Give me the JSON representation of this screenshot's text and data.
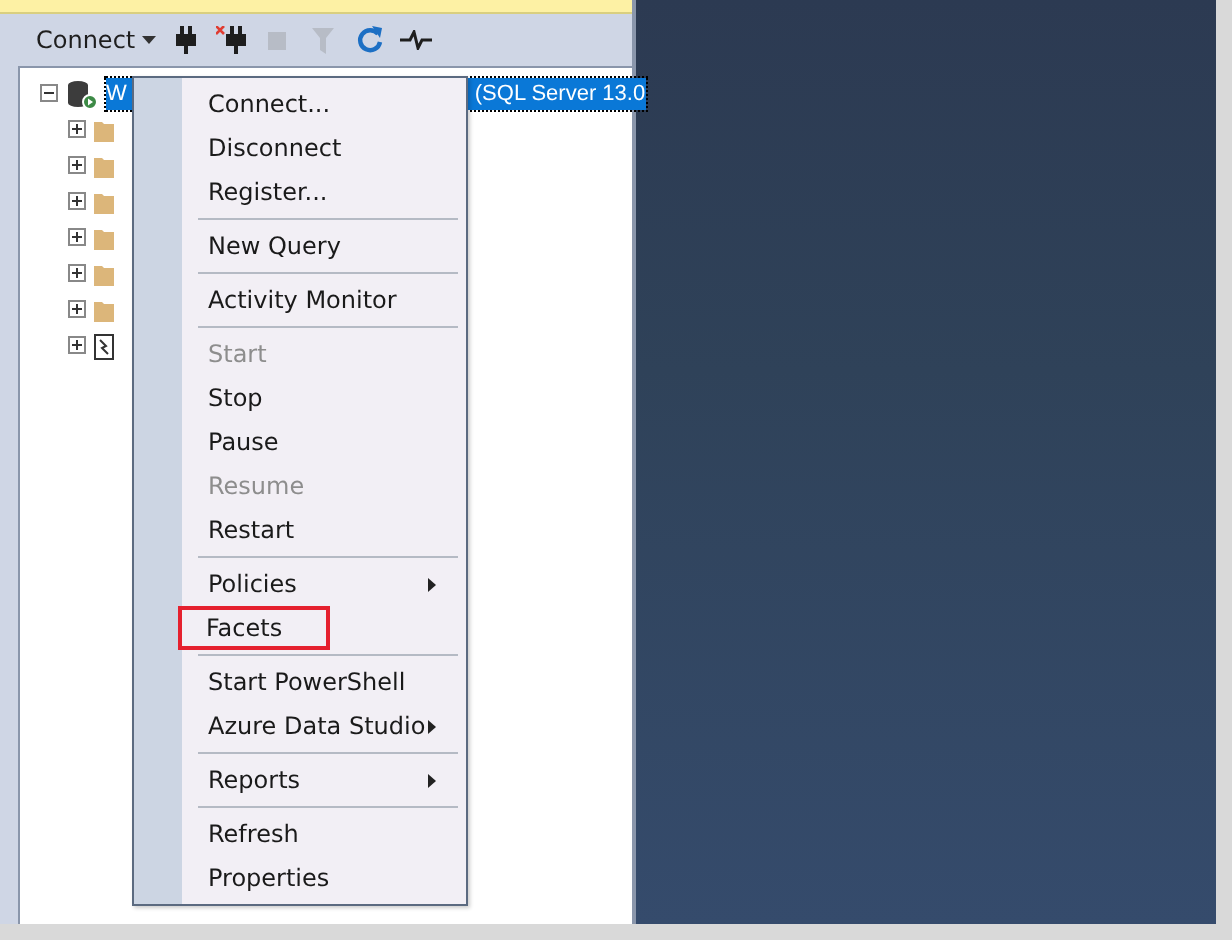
{
  "toolbar": {
    "connect_label": "Connect",
    "buttons": [
      {
        "kind": "connect",
        "disabled": false
      },
      {
        "kind": "disconnect",
        "disabled": false
      },
      {
        "kind": "stop",
        "disabled": true
      },
      {
        "kind": "filter",
        "disabled": true
      },
      {
        "kind": "refresh",
        "disabled": false
      },
      {
        "kind": "activity",
        "disabled": false
      }
    ]
  },
  "tree": {
    "server": {
      "label_start": "W",
      "label_end": "(SQL Server 13.0",
      "selected": true,
      "expanded": true,
      "children": [
        {
          "kind": "folder",
          "expanded": false
        },
        {
          "kind": "folder",
          "expanded": false
        },
        {
          "kind": "folder",
          "expanded": false
        },
        {
          "kind": "folder",
          "expanded": false
        },
        {
          "kind": "folder",
          "expanded": false
        },
        {
          "kind": "folder",
          "expanded": false
        },
        {
          "kind": "agent",
          "expanded": false
        }
      ]
    }
  },
  "context_menu": {
    "items": [
      {
        "kind": "item",
        "label": "Connect...",
        "disabled": false,
        "submenu": false,
        "outlined": false
      },
      {
        "kind": "item",
        "label": "Disconnect",
        "disabled": false,
        "submenu": false,
        "outlined": false
      },
      {
        "kind": "item",
        "label": "Register...",
        "disabled": false,
        "submenu": false,
        "outlined": false
      },
      {
        "kind": "separator"
      },
      {
        "kind": "item",
        "label": "New Query",
        "disabled": false,
        "submenu": false,
        "outlined": false
      },
      {
        "kind": "separator"
      },
      {
        "kind": "item",
        "label": "Activity Monitor",
        "disabled": false,
        "submenu": false,
        "outlined": false
      },
      {
        "kind": "separator"
      },
      {
        "kind": "item",
        "label": "Start",
        "disabled": true,
        "submenu": false,
        "outlined": false
      },
      {
        "kind": "item",
        "label": "Stop",
        "disabled": false,
        "submenu": false,
        "outlined": false
      },
      {
        "kind": "item",
        "label": "Pause",
        "disabled": false,
        "submenu": false,
        "outlined": false
      },
      {
        "kind": "item",
        "label": "Resume",
        "disabled": true,
        "submenu": false,
        "outlined": false
      },
      {
        "kind": "item",
        "label": "Restart",
        "disabled": false,
        "submenu": false,
        "outlined": false
      },
      {
        "kind": "separator"
      },
      {
        "kind": "item",
        "label": "Policies",
        "disabled": false,
        "submenu": true,
        "outlined": false
      },
      {
        "kind": "item",
        "label": "Facets",
        "disabled": false,
        "submenu": false,
        "outlined": true
      },
      {
        "kind": "separator"
      },
      {
        "kind": "item",
        "label": "Start PowerShell",
        "disabled": false,
        "submenu": false,
        "outlined": false
      },
      {
        "kind": "item",
        "label": "Azure Data Studio",
        "disabled": false,
        "submenu": true,
        "outlined": false
      },
      {
        "kind": "separator"
      },
      {
        "kind": "item",
        "label": "Reports",
        "disabled": false,
        "submenu": true,
        "outlined": false
      },
      {
        "kind": "separator"
      },
      {
        "kind": "item",
        "label": "Refresh",
        "disabled": false,
        "submenu": false,
        "outlined": false
      },
      {
        "kind": "item",
        "label": "Properties",
        "disabled": false,
        "submenu": false,
        "outlined": false
      }
    ]
  }
}
